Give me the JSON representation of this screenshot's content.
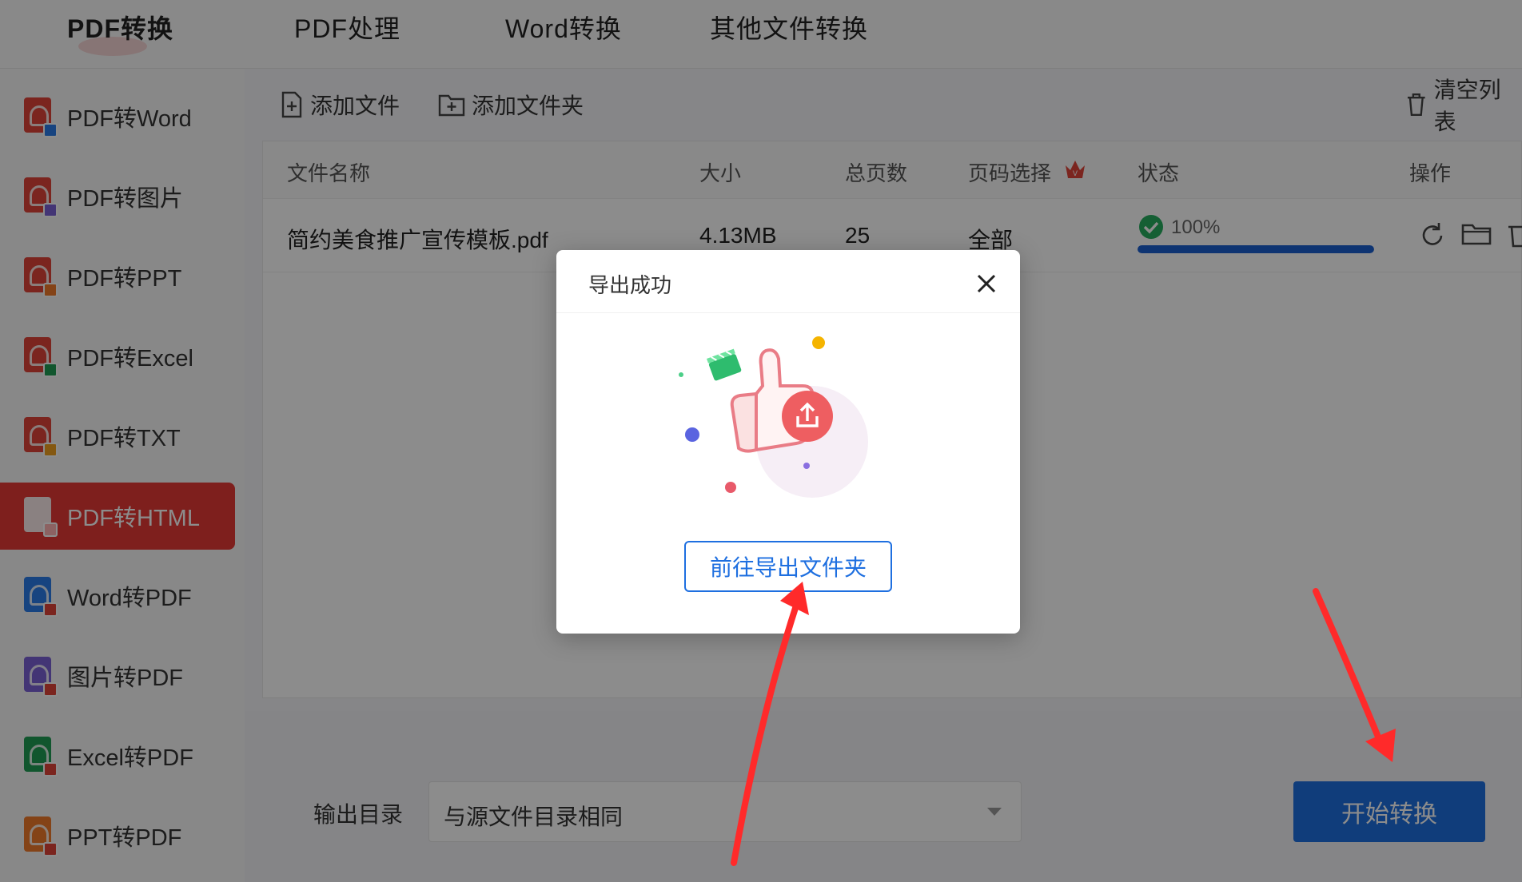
{
  "topnav": {
    "tabs": [
      {
        "label": "PDF转换"
      },
      {
        "label": "PDF处理"
      },
      {
        "label": "Word转换"
      },
      {
        "label": "其他文件转换"
      }
    ]
  },
  "sidebar": {
    "items": [
      {
        "label": "PDF转Word",
        "icon": "pdf-to-word-icon"
      },
      {
        "label": "PDF转图片",
        "icon": "pdf-to-image-icon"
      },
      {
        "label": "PDF转PPT",
        "icon": "pdf-to-ppt-icon"
      },
      {
        "label": "PDF转Excel",
        "icon": "pdf-to-excel-icon"
      },
      {
        "label": "PDF转TXT",
        "icon": "pdf-to-txt-icon"
      },
      {
        "label": "PDF转HTML",
        "icon": "pdf-to-html-icon",
        "active": true
      },
      {
        "label": "Word转PDF",
        "icon": "word-to-pdf-icon"
      },
      {
        "label": "图片转PDF",
        "icon": "image-to-pdf-icon"
      },
      {
        "label": "Excel转PDF",
        "icon": "excel-to-pdf-icon"
      },
      {
        "label": "PPT转PDF",
        "icon": "ppt-to-pdf-icon"
      }
    ]
  },
  "toolbar": {
    "add_file": "添加文件",
    "add_folder": "添加文件夹",
    "clear_list": "清空列表"
  },
  "table": {
    "headers": {
      "name": "文件名称",
      "size": "大小",
      "pages": "总页数",
      "page_select": "页码选择",
      "status": "状态",
      "actions": "操作"
    },
    "rows": [
      {
        "name": "简约美食推广宣传模板.pdf",
        "size": "4.13MB",
        "pages": "25",
        "page_select": "全部",
        "progress_text": "100%",
        "progress": 1.0
      }
    ]
  },
  "bottom": {
    "output_label": "输出目录",
    "output_value": "与源文件目录相同",
    "start_button": "开始转换"
  },
  "modal": {
    "title": "导出成功",
    "button": "前往导出文件夹"
  },
  "colors": {
    "accent_red": "#e53935",
    "primary_blue": "#1e6fe0",
    "success_green": "#27ae60",
    "annotation_red": "#ff2a2a"
  }
}
